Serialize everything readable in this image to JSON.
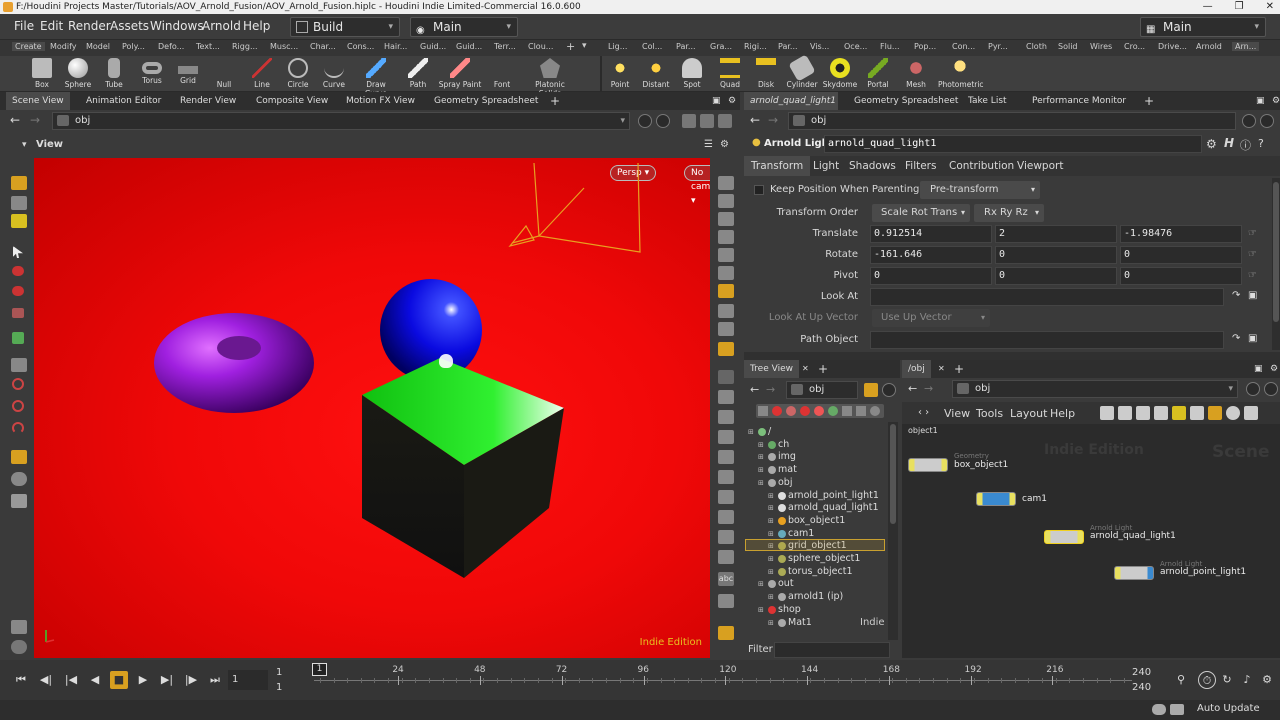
{
  "window": {
    "title": "F:/Houdini Projects Master/Tutorials/AOV_Arnold_Fusion/AOV_Arnold_Fusion.hiplc - Houdini Indie Limited-Commercial 16.0.600"
  },
  "menu": {
    "items": [
      "File",
      "Edit",
      "Render",
      "Assets",
      "Windows",
      "Arnold",
      "Help"
    ],
    "desktop": "Build",
    "context": "Main",
    "right_context": "Main"
  },
  "shelf_tabs_left": [
    "Create",
    "Modify",
    "Model",
    "Poly...",
    "Defo...",
    "Text...",
    "Rigg...",
    "Musc...",
    "Char...",
    "Cons...",
    "Hair...",
    "Guid...",
    "Guid...",
    "Terr...",
    "Clou..."
  ],
  "shelf_tabs_right": [
    "Lig...",
    "Col...",
    "Par...",
    "Gra...",
    "Rigi...",
    "Par...",
    "Vis...",
    "Oce...",
    "Flu...",
    "Pop...",
    "Con...",
    "Pyr...",
    "Cloth",
    "Solid",
    "Wires",
    "Cro...",
    "Drive...",
    "Arnold",
    "Arn..."
  ],
  "shelf_tools_left": [
    "Box",
    "Sphere",
    "Tube",
    "Torus",
    "Grid",
    "Null",
    "Line",
    "Circle",
    "Curve",
    "Draw Curve",
    "Path",
    "Spray Paint",
    "Font",
    "Platonic Solids"
  ],
  "shelf_tools_right": [
    "Point",
    "Distant",
    "Spot",
    "Quad",
    "Disk",
    "Cylinder",
    "Skydome",
    "Portal",
    "Mesh",
    "Photometric"
  ],
  "left_pane": {
    "tabs": [
      "Scene View",
      "Animation Editor",
      "Render View",
      "Composite View",
      "Motion FX View",
      "Geometry Spreadsheet"
    ],
    "path": "obj",
    "view_label": "View",
    "camera_mode": "Persp",
    "camera": "No cam",
    "watermark": "Indie Edition"
  },
  "param_pane": {
    "tabs": [
      "arnold_quad_light1",
      "Geometry Spreadsheet",
      "Take List",
      "Performance Monitor"
    ],
    "path": "obj",
    "node_type": "Arnold Light",
    "node_name": "arnold_quad_light1",
    "subtabs": [
      "Transform",
      "Light",
      "Shadows",
      "Filters",
      "Contribution",
      "Viewport"
    ],
    "keep_position_label": "Keep Position When Parenting",
    "keep_position_value": "Pre-transform",
    "transform_order_label": "Transform Order",
    "transform_order_value": "Scale Rot Trans",
    "rot_order_value": "Rx Ry Rz",
    "translate_label": "Translate",
    "translate": [
      "0.912514",
      "2",
      "-1.98476"
    ],
    "rotate_label": "Rotate",
    "rotate": [
      "-161.646",
      "0",
      "0"
    ],
    "pivot_label": "Pivot",
    "pivot": [
      "0",
      "0",
      "0"
    ],
    "look_at_label": "Look At",
    "look_at_up_label": "Look At Up Vector",
    "look_at_up_value": "Use Up Vector",
    "path_object_label": "Path Object"
  },
  "tree_pane": {
    "tab": "Tree View",
    "path": "obj",
    "items": [
      {
        "label": "/"
      },
      {
        "label": "ch"
      },
      {
        "label": "img"
      },
      {
        "label": "mat"
      },
      {
        "label": "obj"
      },
      {
        "label": "arnold_point_light1"
      },
      {
        "label": "arnold_quad_light1"
      },
      {
        "label": "box_object1"
      },
      {
        "label": "cam1"
      },
      {
        "label": "grid_object1"
      },
      {
        "label": "sphere_object1"
      },
      {
        "label": "torus_object1"
      },
      {
        "label": "out"
      },
      {
        "label": "arnold1 (ip)"
      },
      {
        "label": "shop"
      },
      {
        "label": "Mat1"
      }
    ],
    "indie_label": "Indie",
    "filter_label": "Filter"
  },
  "network_pane": {
    "tab": "/obj",
    "path": "obj",
    "menu": [
      "View",
      "Tools",
      "Layout",
      "Help"
    ],
    "breadcrumb": "object1",
    "watermark1": "Indie Edition",
    "watermark2": "Scene",
    "nodes": [
      {
        "type": "Geometry",
        "name": "box_object1"
      },
      {
        "type": "",
        "name": "cam1"
      },
      {
        "type": "Arnold Light",
        "name": "arnold_quad_light1"
      },
      {
        "type": "Arnold Light",
        "name": "arnold_point_light1"
      }
    ]
  },
  "timeline": {
    "current_frame": "1",
    "start_frame": "1",
    "start_frame2": "1",
    "end_frame": "240",
    "end_frame2": "240",
    "ticks": [
      "24",
      "48",
      "72",
      "96",
      "120",
      "144",
      "168",
      "192",
      "216"
    ],
    "marker": "1"
  },
  "status": {
    "auto_update": "Auto Update"
  },
  "colors": {
    "viewport_bg": "#ff0a0a",
    "torus": "#a020e0",
    "sphere": "#1010e0",
    "cube_top": "#10d010",
    "accent": "#d8a020"
  }
}
